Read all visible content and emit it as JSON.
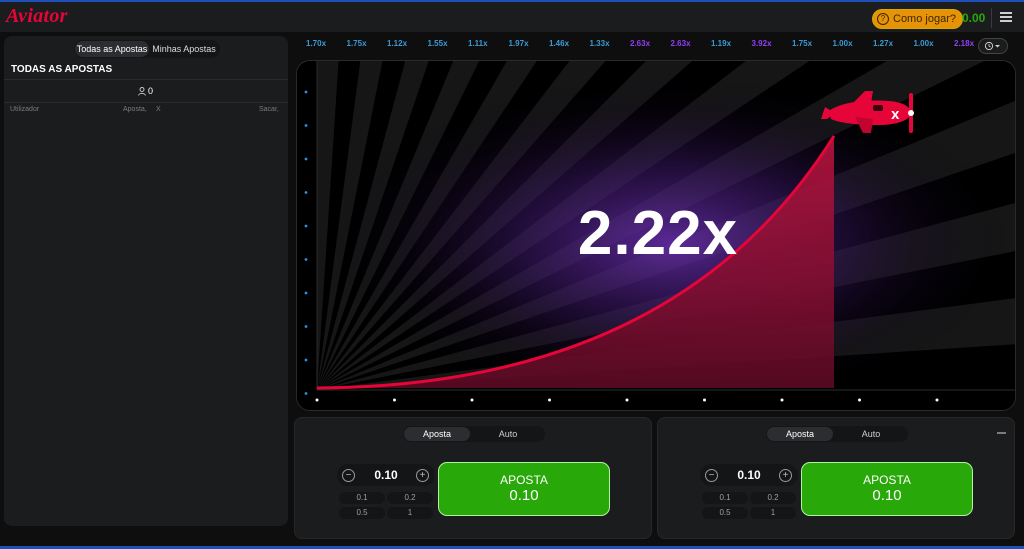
{
  "header": {
    "logo": "Aviator",
    "how_to_play": "Como jogar?",
    "balance": "0.00"
  },
  "sidebar": {
    "tabs": [
      {
        "label": "Todas as Apostas",
        "active": true
      },
      {
        "label": "Minhas Apostas",
        "active": false
      }
    ],
    "title": "TODAS AS APOSTAS",
    "player_count": "0",
    "columns": {
      "user": "Utilizador",
      "bet": "Aposta,",
      "mult": "X",
      "cashout": "Sacar,"
    }
  },
  "history": [
    {
      "value": "1.70x",
      "color": "#3c9bd6"
    },
    {
      "value": "1.75x",
      "color": "#3c9bd6"
    },
    {
      "value": "1.12x",
      "color": "#3c9bd6"
    },
    {
      "value": "1.55x",
      "color": "#3c9bd6"
    },
    {
      "value": "1.11x",
      "color": "#3c9bd6"
    },
    {
      "value": "1.97x",
      "color": "#3c9bd6"
    },
    {
      "value": "1.46x",
      "color": "#3c9bd6"
    },
    {
      "value": "1.33x",
      "color": "#3c9bd6"
    },
    {
      "value": "2.63x",
      "color": "#913ef8"
    },
    {
      "value": "2.63x",
      "color": "#913ef8"
    },
    {
      "value": "1.19x",
      "color": "#3c9bd6"
    },
    {
      "value": "3.92x",
      "color": "#913ef8"
    },
    {
      "value": "1.75x",
      "color": "#3c9bd6"
    },
    {
      "value": "1.00x",
      "color": "#3c9bd6"
    },
    {
      "value": "1.27x",
      "color": "#3c9bd6"
    },
    {
      "value": "1.00x",
      "color": "#3c9bd6"
    },
    {
      "value": "2.18x",
      "color": "#913ef8"
    }
  ],
  "game": {
    "multiplier": "2.22x",
    "accent": "#e50539"
  },
  "bet_panels": [
    {
      "tabs": [
        {
          "label": "Aposta",
          "active": true
        },
        {
          "label": "Auto",
          "active": false
        }
      ],
      "amount": "0.10",
      "quick": [
        "0.1",
        "0.2",
        "0.5",
        "1"
      ],
      "button_label": "APOSTA",
      "button_amount": "0.10"
    },
    {
      "tabs": [
        {
          "label": "Aposta",
          "active": true
        },
        {
          "label": "Auto",
          "active": false
        }
      ],
      "amount": "0.10",
      "quick": [
        "0.1",
        "0.2",
        "0.5",
        "1"
      ],
      "button_label": "APOSTA",
      "button_amount": "0.10"
    }
  ]
}
